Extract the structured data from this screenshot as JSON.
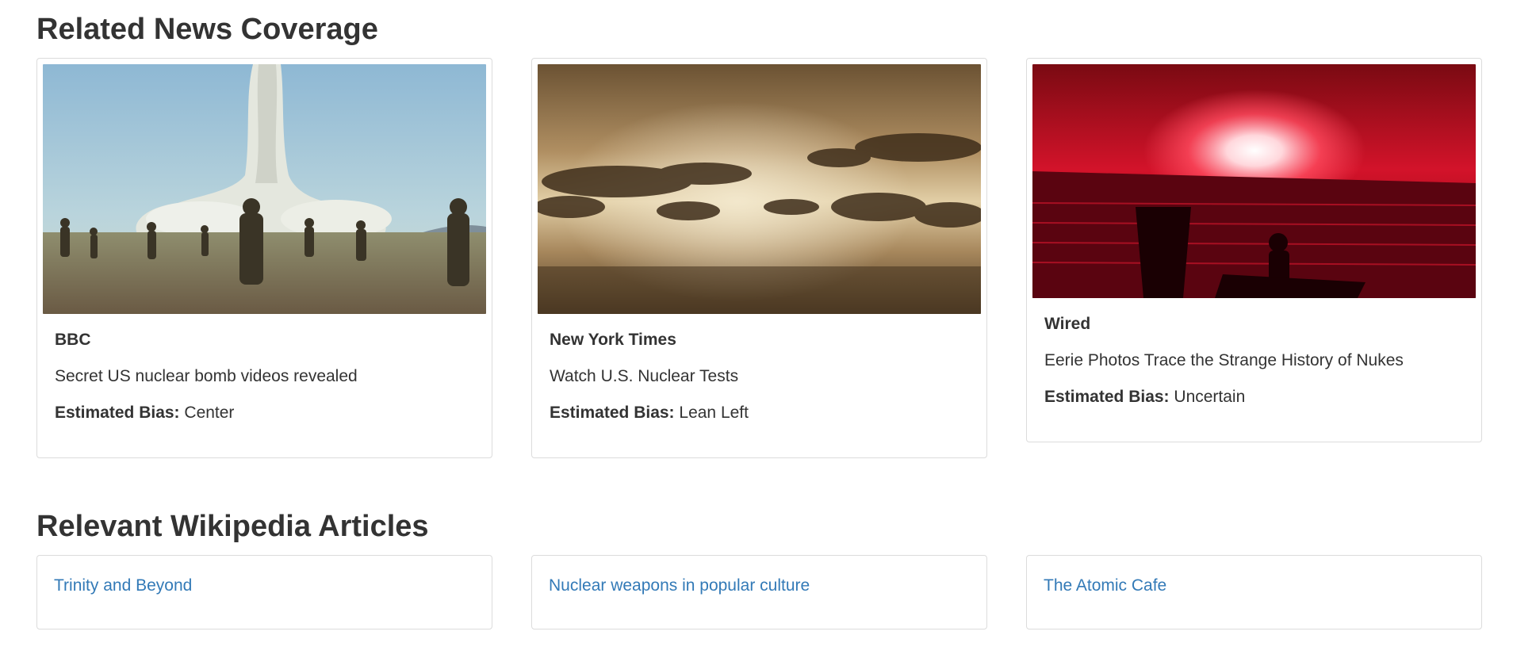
{
  "news_section": {
    "title": "Related News Coverage",
    "cards": [
      {
        "image": "soldiers-nuclear-test-photo",
        "source": "BBC",
        "headline": "Secret US nuclear bomb videos revealed",
        "bias_label": "Estimated Bias:",
        "bias_value": " Center"
      },
      {
        "image": "sepia-explosion-clouds-photo",
        "source": "New York Times",
        "headline": "Watch U.S. Nuclear Tests",
        "bias_label": "Estimated Bias:",
        "bias_value": " Lean Left"
      },
      {
        "image": "red-nuclear-flash-over-sea-photo",
        "source": "Wired",
        "headline": "Eerie Photos Trace the Strange History of Nukes",
        "bias_label": "Estimated Bias:",
        "bias_value": " Uncertain"
      }
    ]
  },
  "wiki_section": {
    "title": "Relevant Wikipedia Articles",
    "links": [
      "Trinity and Beyond",
      "Nuclear weapons in popular culture",
      "The Atomic Cafe"
    ]
  },
  "colors": {
    "link": "#337ab7",
    "text": "#333333",
    "border": "#dcdcdc"
  }
}
